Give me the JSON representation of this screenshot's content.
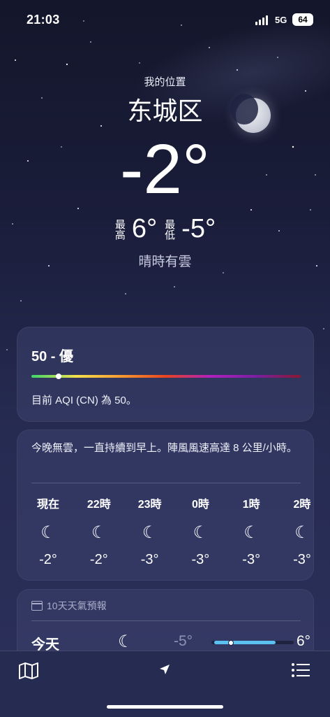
{
  "status": {
    "time": "21:03",
    "network": "5G",
    "battery": "64"
  },
  "location": {
    "label": "我的位置",
    "city": "东城区"
  },
  "current": {
    "temp": "-2°",
    "high_label": "最高",
    "high": "6°",
    "low_label": "最低",
    "low": "-5°",
    "condition": "晴時有雲"
  },
  "aqi": {
    "value": "50 - 優",
    "description": "目前 AQI (CN) 為 50。",
    "level_fraction": 0.1
  },
  "hourly": {
    "summary": "今晚無雲，一直持續到早上。陣風風速高達 8 公里/小時。",
    "items": [
      {
        "hour": "現在",
        "icon": "moon-stars-icon",
        "temp": "-2°"
      },
      {
        "hour": "22時",
        "icon": "moon-stars-icon",
        "temp": "-2°"
      },
      {
        "hour": "23時",
        "icon": "moon-stars-icon",
        "temp": "-3°"
      },
      {
        "hour": "0時",
        "icon": "moon-stars-icon",
        "temp": "-3°"
      },
      {
        "hour": "1時",
        "icon": "moon-stars-icon",
        "temp": "-3°"
      },
      {
        "hour": "2時",
        "icon": "moon-stars-icon",
        "temp": "-3°"
      }
    ]
  },
  "daily": {
    "header": "10天天氣預報",
    "rows": [
      {
        "day": "今天",
        "icon": "moon-stars-icon",
        "low": "-5°",
        "high": "6°"
      }
    ]
  },
  "toolbar": {
    "map_icon": "map-icon",
    "location_icon": "location-arrow-icon",
    "list_icon": "list-icon"
  },
  "colors": {
    "range_fill": "#5bc1f0",
    "background": "#1a1d3a"
  }
}
